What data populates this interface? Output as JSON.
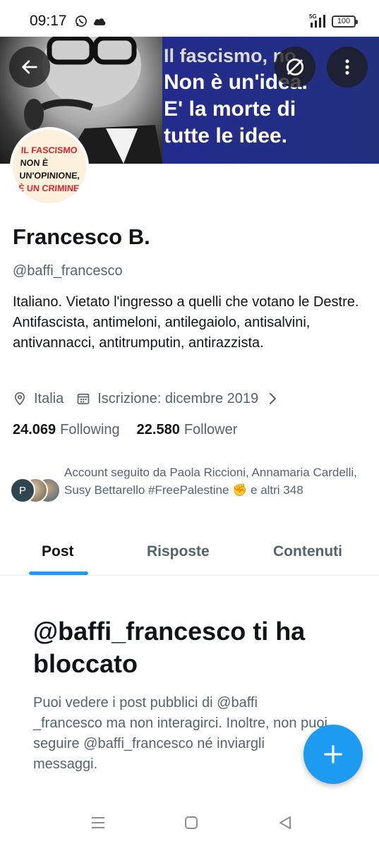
{
  "status_bar": {
    "time": "09:17",
    "network": "5G",
    "battery": "100",
    "icons": [
      "whatsapp-icon",
      "cloud-icon",
      "signal-icon",
      "battery-icon"
    ]
  },
  "banner": {
    "line1": "Il fascismo, no.",
    "line2": "Non è un'idea.",
    "line3": "E' la morte di",
    "line4": "tutte le idee."
  },
  "avatar_badge": {
    "line1": "IL FASCISMO",
    "line2": "NON È",
    "line3": "UN'OPINIONE,",
    "line4": "È UN CRIMINE"
  },
  "profile": {
    "name": "Francesco B.",
    "handle": "@baffi_francesco",
    "bio": "Italiano. Vietato l'ingresso a quelli che votano le Destre. Antifascista, antimeloni, antilegaiolo, antisalvini, antivannacci, antitrumputin, antirazzista.",
    "location": "Italia",
    "joined": "Iscrizione: dicembre 2019",
    "following_count": "24.069",
    "following_label": "Following",
    "followers_count": "22.580",
    "followers_label": "Follower"
  },
  "followed_by": {
    "avatar_letter": "P",
    "text": "Account seguito da Paola Riccioni, Annamaria Cardelli, Susy Bettarello #FreePalestine ✊ e altri 348"
  },
  "tabs": [
    {
      "label": "Post",
      "active": true
    },
    {
      "label": "Risposte",
      "active": false
    },
    {
      "label": "Contenuti",
      "active": false
    }
  ],
  "blocked": {
    "title": "@baffi_francesco ti ha bloccato",
    "body": "Puoi vedere i post pubblici di @baffi _francesco ma non interagirci. Inoltre, non puoi seguire @baffi_francesco né inviargli messaggi."
  },
  "colors": {
    "accent": "#1d9bf0",
    "text_primary": "#0f1419",
    "text_secondary": "#536471",
    "banner_blue": "#232c8c"
  }
}
